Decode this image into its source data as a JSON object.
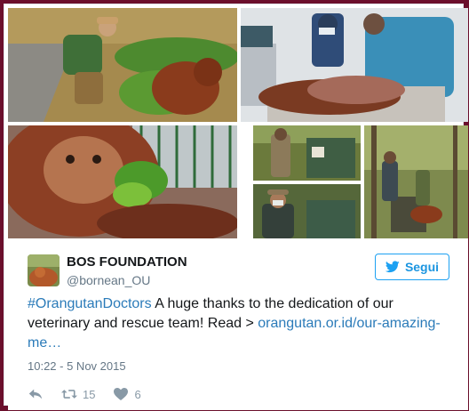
{
  "account": {
    "display_name": "BOS FOUNDATION",
    "handle": "@bornean_OU"
  },
  "follow_button": {
    "label": "Segui",
    "icon": "twitter-bird-icon"
  },
  "tweet": {
    "hashtag": "#OrangutanDoctors",
    "body": " A huge thanks to the dedication of our veterinary and rescue team! Read > ",
    "link": "orangutan.or.id/our-amazing-me…",
    "timestamp": "10:22 - 5 Nov 2015"
  },
  "stats": {
    "retweets": "15",
    "likes": "6"
  },
  "icons": {
    "reply": "reply-icon",
    "retweet": "retweet-icon",
    "like": "heart-icon"
  },
  "colors": {
    "page_background": "#6b0f2c",
    "link": "#2b7bb9",
    "follow_accent": "#1da1f2",
    "muted": "#8899a6"
  },
  "photo_grid": {
    "count": 6
  }
}
